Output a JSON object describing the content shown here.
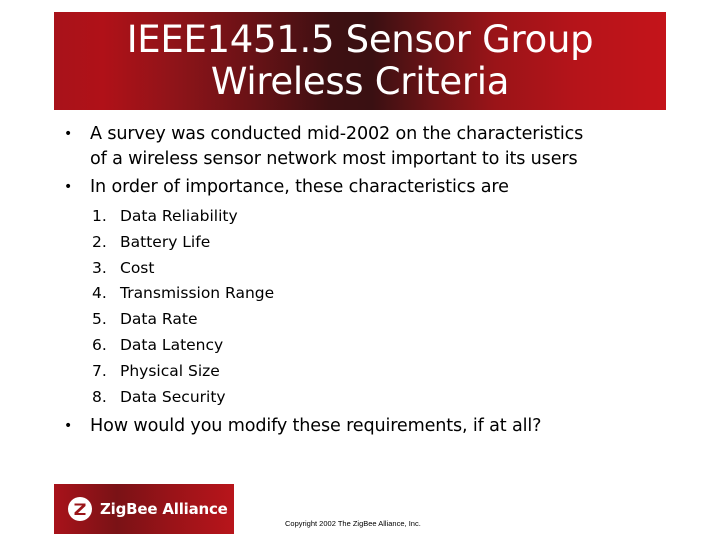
{
  "slide": {
    "title_lines": [
      "IEEE1451.5 Sensor Group",
      "Wireless Criteria"
    ],
    "bullets": [
      {
        "lines": [
          "A survey was conducted mid-2002 on the characteristics",
          "of a wireless sensor network most important to its users"
        ]
      },
      {
        "lines": [
          "In order of importance, these characteristics are"
        ]
      }
    ],
    "ranked_characteristics": [
      {
        "number": "1.",
        "label": "Data Reliability"
      },
      {
        "number": "2.",
        "label": "Battery Life"
      },
      {
        "number": "3.",
        "label": "Cost"
      },
      {
        "number": "4.",
        "label": "Transmission Range"
      },
      {
        "number": "5.",
        "label": "Data Rate"
      },
      {
        "number": "6.",
        "label": "Data Latency"
      },
      {
        "number": "7.",
        "label": "Physical Size"
      },
      {
        "number": "8.",
        "label": "Data Security"
      }
    ],
    "final_bullet": "How would you modify these requirements, if at all?",
    "bullet_glyph": "•"
  },
  "footer": {
    "logo_text": "ZigBee Alliance",
    "logo_icon": "zigbee-z-icon",
    "copyright": "Copyright 2002 The ZigBee Alliance, Inc."
  },
  "colors": {
    "banner_red": "#c4141a",
    "banner_dark": "#3a1012",
    "text": "#000000",
    "title_text": "#ffffff"
  }
}
